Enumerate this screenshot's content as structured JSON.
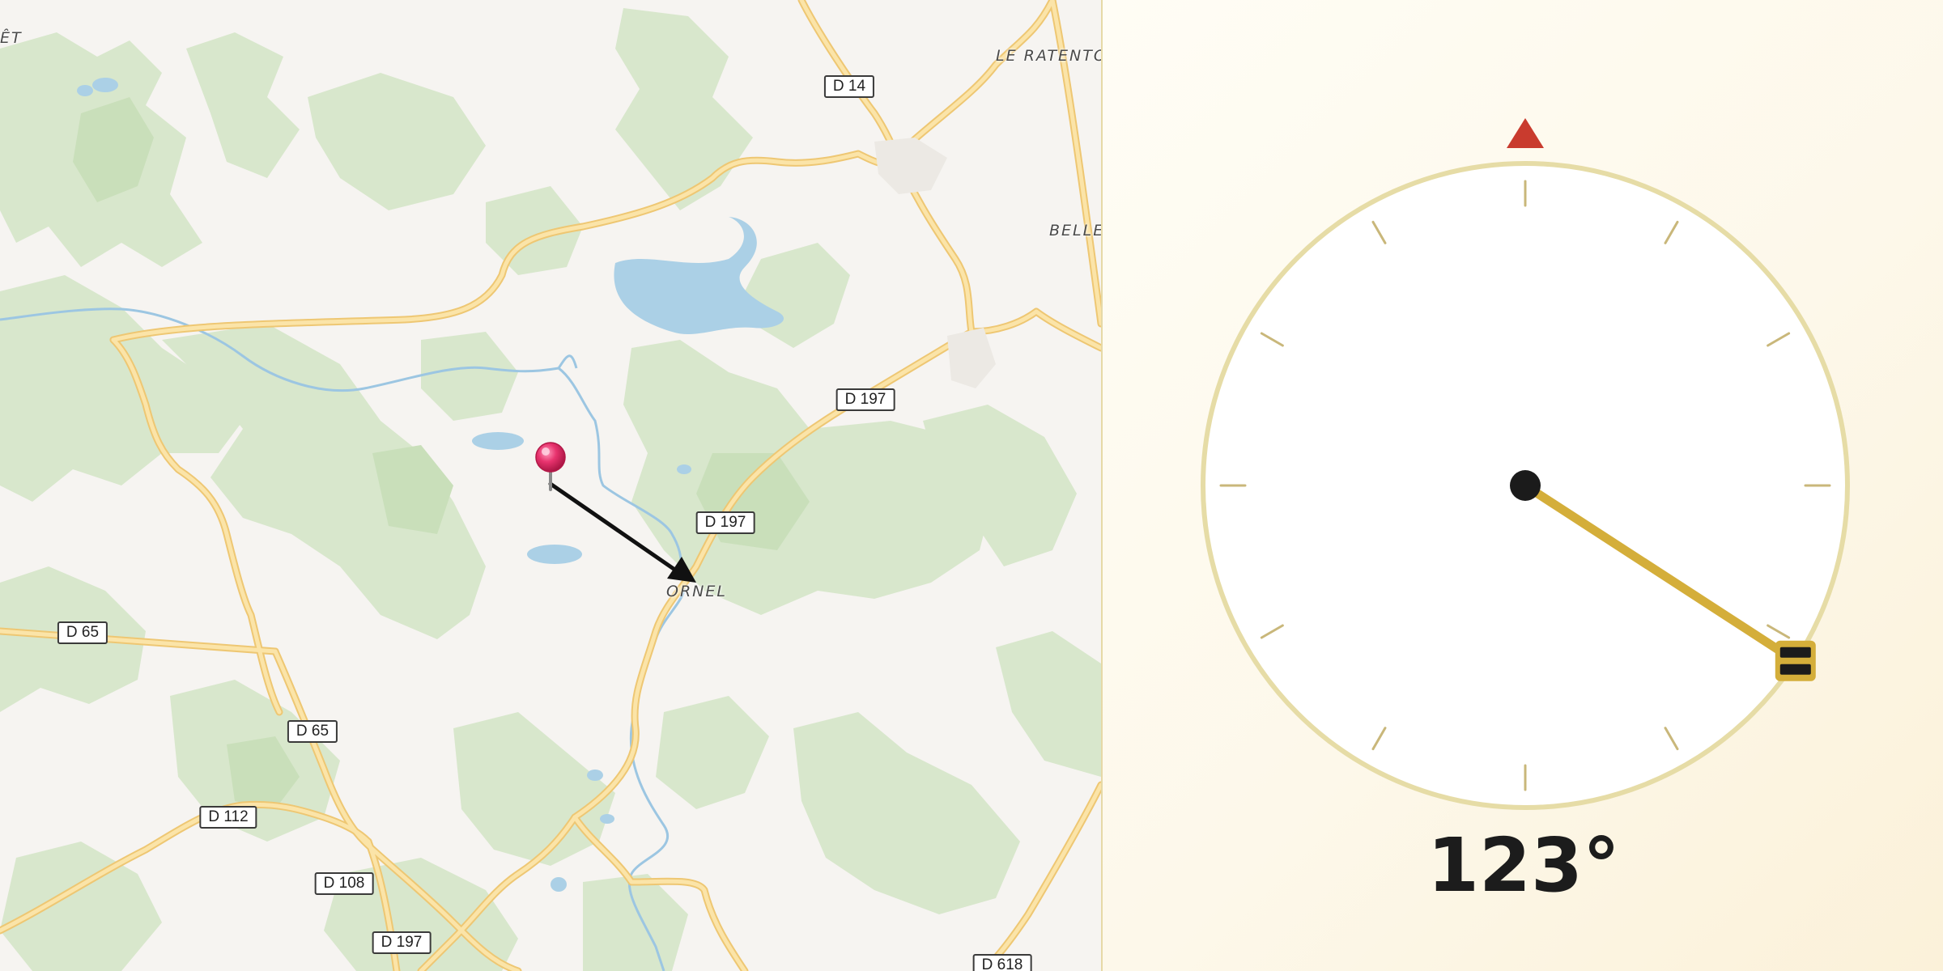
{
  "map": {
    "place_labels": {
      "foret": "ÊT",
      "ratentou": "LE RATENTOU",
      "bellev": "BELLEV",
      "ornel": "ORNEL"
    },
    "road_labels": {
      "d14": "D 14",
      "d197_north": "D 197",
      "d197_mid": "D 197",
      "d197_south": "D 197",
      "d65_west": "D 65",
      "d65_south": "D 65",
      "d112": "D 112",
      "d108": "D 108",
      "d618": "D 618"
    },
    "icons": {
      "pin": "map-pin-icon",
      "arrow": "direction-arrow-icon"
    },
    "colors": {
      "pin": "#e8336e",
      "arrow": "#111111",
      "road": "#f7d58a",
      "forest": "#d7e6cb",
      "water": "#abd0e6"
    }
  },
  "compass": {
    "heading_deg": 123,
    "heading_label": "123°",
    "colors": {
      "ring": "#e6dca6",
      "tick": "#c9b77a",
      "north_marker": "#c93b2e",
      "needle": "#d4ae3a",
      "hub": "#1b1b1b"
    },
    "icons": {
      "north": "north-marker-icon",
      "handle": "drag-handle-icon"
    }
  }
}
